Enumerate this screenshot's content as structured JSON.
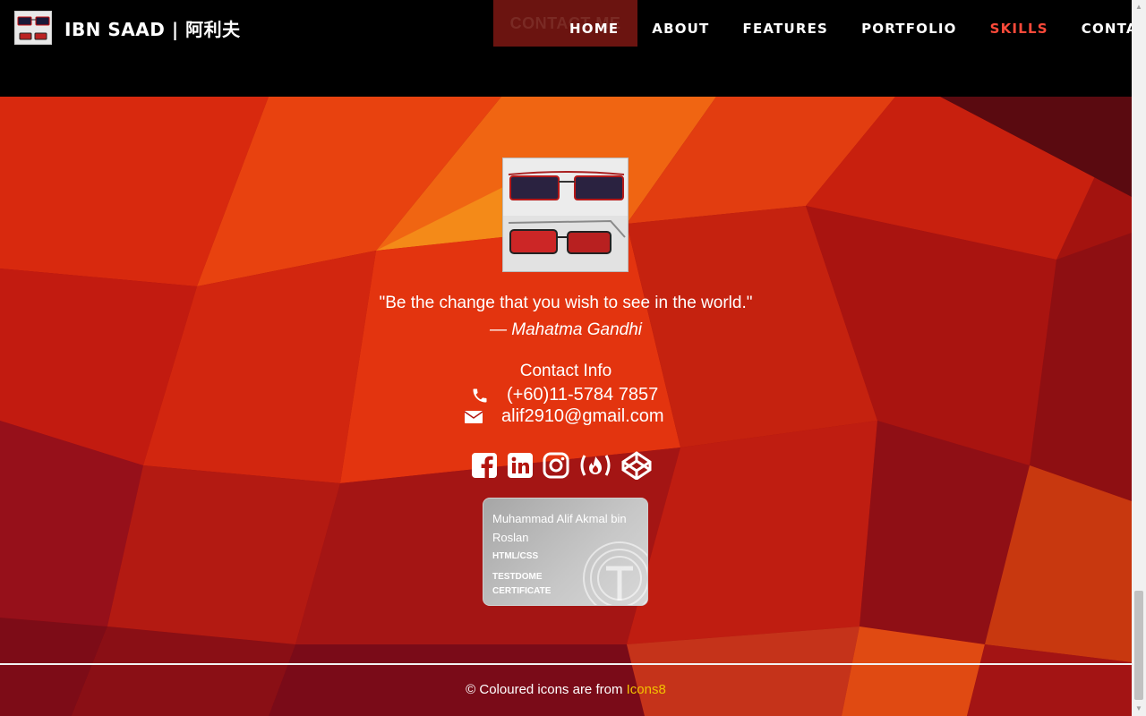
{
  "navbar": {
    "brand": "IBN SAAD | 阿利夫",
    "contact_button": "CONTACT ME",
    "items": [
      {
        "label": "HOME",
        "active": false
      },
      {
        "label": "ABOUT",
        "active": false
      },
      {
        "label": "FEATURES",
        "active": false
      },
      {
        "label": "PORTFOLIO",
        "active": false
      },
      {
        "label": "SKILLS",
        "active": true
      },
      {
        "label": "CONTACT",
        "active": false
      }
    ],
    "active_color": "#ff4a3a"
  },
  "footer": {
    "quote": "\"Be the change that you wish to see in the world.\"",
    "author": "— Mahatma Gandhi",
    "contact_title": "Contact Info",
    "phone": "(+60)11-5784 7857",
    "email": "alif2910@gmail.com",
    "socials": [
      "facebook-icon",
      "linkedin-icon",
      "instagram-icon",
      "freecodecamp-icon",
      "codepen-icon"
    ],
    "badge": {
      "name": "Muhammad Alif Akmal bin Roslan",
      "skill": "HTML/CSS",
      "issuer": "TESTDOME CERTIFICATE"
    },
    "credit_text": "© Coloured icons are from",
    "credit_link": "Icons8",
    "credit_link_color": "#f2c200"
  }
}
